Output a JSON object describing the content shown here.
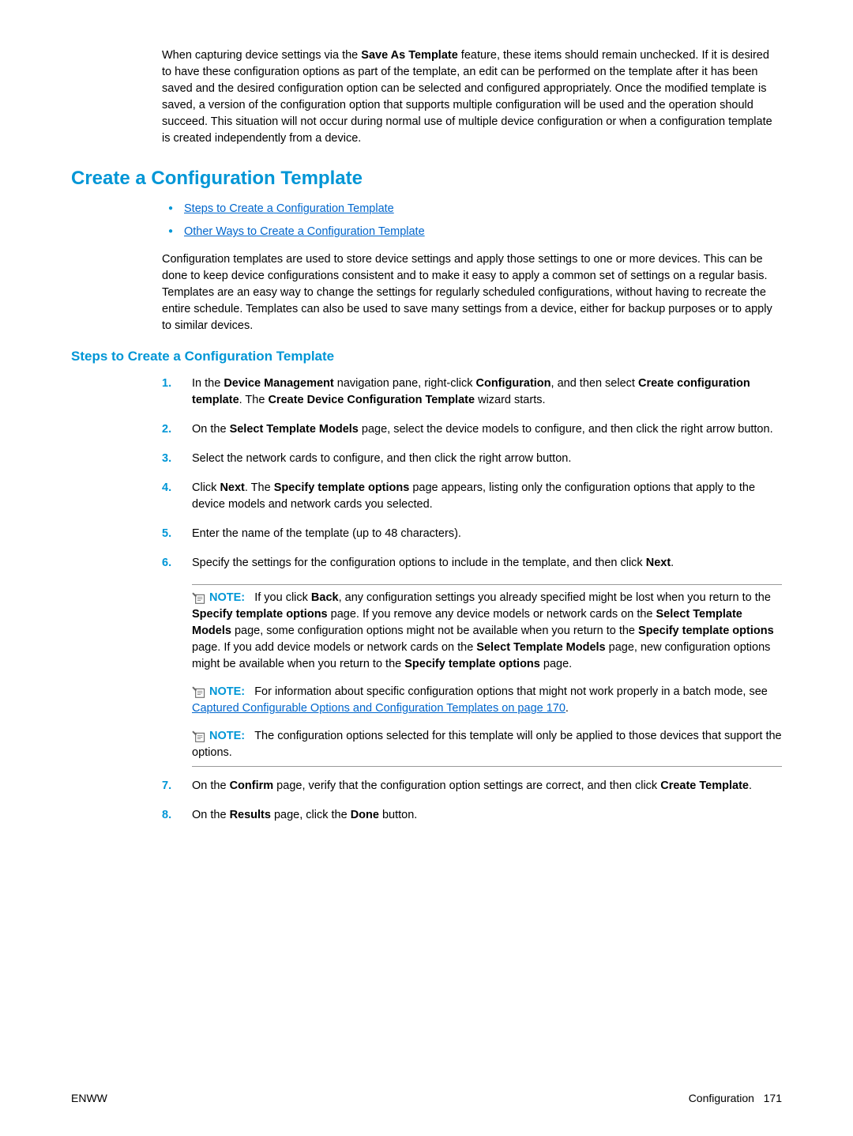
{
  "intro": {
    "text_parts": [
      "When capturing device settings via the ",
      "Save As Template",
      " feature, these items should remain unchecked. If it is desired to have these configuration options as part of the template, an edit can be performed on the template after it has been saved and the desired configuration option can be selected and configured appropriately. Once the modified template is saved, a version of the configuration option that supports multiple configuration will be used and the operation should succeed. This situation will not occur during normal use of multiple device configuration or when a configuration template is created independently from a device."
    ]
  },
  "h2": "Create a Configuration Template",
  "bullets": [
    "Steps to Create a Configuration Template",
    "Other Ways to Create a Configuration Template"
  ],
  "config_para": "Configuration templates are used to store device settings and apply those settings to one or more devices. This can be done to keep device configurations consistent and to make it easy to apply a common set of settings on a regular basis. Templates are an easy way to change the settings for regularly scheduled configurations, without having to recreate the entire schedule. Templates can also be used to save many settings from a device, either for backup purposes or to apply to similar devices.",
  "h3": "Steps to Create a Configuration Template",
  "steps": {
    "s1": {
      "num": "1.",
      "parts": [
        "In the ",
        "Device Management",
        " navigation pane, right-click ",
        "Configuration",
        ", and then select ",
        "Create configuration template",
        ". The ",
        "Create Device Configuration Template",
        " wizard starts."
      ]
    },
    "s2": {
      "num": "2.",
      "parts": [
        "On the ",
        "Select Template Models",
        " page, select the device models to configure, and then click the right arrow button."
      ]
    },
    "s3": {
      "num": "3.",
      "text": "Select the network cards to configure, and then click the right arrow button."
    },
    "s4": {
      "num": "4.",
      "parts": [
        "Click ",
        "Next",
        ". The ",
        "Specify template options",
        " page appears, listing only the configuration options that apply to the device models and network cards you selected."
      ]
    },
    "s5": {
      "num": "5.",
      "text": "Enter the name of the template (up to 48 characters)."
    },
    "s6": {
      "num": "6.",
      "parts": [
        "Specify the settings for the configuration options to include in the template, and then click ",
        "Next",
        "."
      ]
    },
    "s7": {
      "num": "7.",
      "parts": [
        "On the ",
        "Confirm",
        " page, verify that the configuration option settings are correct, and then click ",
        "Create Template",
        "."
      ]
    },
    "s8": {
      "num": "8.",
      "parts": [
        "On the ",
        "Results",
        " page, click the ",
        "Done",
        " button."
      ]
    }
  },
  "notes": {
    "label": "NOTE:",
    "n1": {
      "parts": [
        "If you click ",
        "Back",
        ", any configuration settings you already specified might be lost when you return to the ",
        "Specify template options",
        " page. If you remove any device models or network cards on the ",
        "Select Template Models",
        " page, some configuration options might not be available when you return to the ",
        "Specify template options",
        " page. If you add device models or network cards on the ",
        "Select Template Models",
        " page, new configuration options might be available when you return to the ",
        "Specify template options",
        " page."
      ]
    },
    "n2": {
      "pre": "For information about specific configuration options that might not work properly in a batch mode, see ",
      "link": "Captured Configurable Options and Configuration Templates on page 170",
      "post": "."
    },
    "n3": {
      "text": "The configuration options selected for this template will only be applied to those devices that support the options."
    }
  },
  "footer": {
    "left": "ENWW",
    "right_label": "Configuration",
    "right_page": "171"
  }
}
